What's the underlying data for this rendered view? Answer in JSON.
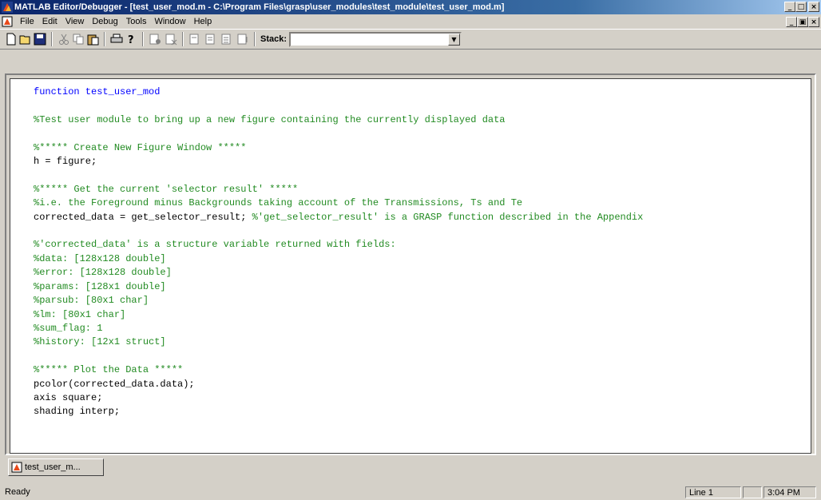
{
  "window": {
    "title": "MATLAB Editor/Debugger - [test_user_mod.m - C:\\Program Files\\grasp\\user_modules\\test_module\\test_user_mod.m]",
    "controls": {
      "minimize": "_",
      "maximize": "□",
      "close": "×"
    }
  },
  "menu": [
    {
      "label": "File"
    },
    {
      "label": "Edit"
    },
    {
      "label": "View"
    },
    {
      "label": "Debug"
    },
    {
      "label": "Tools"
    },
    {
      "label": "Window"
    },
    {
      "label": "Help"
    }
  ],
  "mdi_controls": {
    "minimize": "_",
    "restore": "▣",
    "close": "×"
  },
  "toolbar": {
    "stack_label": "Stack:",
    "stack_value": "",
    "icons": [
      "new-file-icon",
      "open-file-icon",
      "save-icon",
      "cut-icon",
      "copy-icon",
      "paste-icon",
      "print-icon",
      "help-icon",
      "set-breakpoint-icon",
      "clear-breakpoints-icon",
      "step-icon",
      "step-in-icon",
      "step-out-icon",
      "continue-icon"
    ]
  },
  "code_lines": [
    {
      "text": "function test_user_mod",
      "style": "kw"
    },
    {
      "text": "",
      "style": ""
    },
    {
      "text": "%Test user module to bring up a new figure containing the currently displayed data",
      "style": "cm"
    },
    {
      "text": "",
      "style": ""
    },
    {
      "text": "%***** Create New Figure Window *****",
      "style": "cm"
    },
    {
      "text": "h = figure;",
      "style": ""
    },
    {
      "text": "",
      "style": ""
    },
    {
      "text": "%***** Get the current 'selector result' *****",
      "style": "cm"
    },
    {
      "text": "%i.e. the Foreground minus Backgrounds taking account of the Transmissions, Ts and Te",
      "style": "cm"
    },
    {
      "text": "corrected_data = get_selector_result; ",
      "style": "",
      "comment": "%'get_selector_result' is a GRASP function described in the Appendix"
    },
    {
      "text": "",
      "style": ""
    },
    {
      "text": "%'corrected_data' is a structure variable returned with fields:",
      "style": "cm"
    },
    {
      "text": "%data: [128x128 double]",
      "style": "cm"
    },
    {
      "text": "%error: [128x128 double]",
      "style": "cm"
    },
    {
      "text": "%params: [128x1 double]",
      "style": "cm"
    },
    {
      "text": "%parsub: [80x1 char]",
      "style": "cm"
    },
    {
      "text": "%lm: [80x1 char]",
      "style": "cm"
    },
    {
      "text": "%sum_flag: 1",
      "style": "cm"
    },
    {
      "text": "%history: [12x1 struct]",
      "style": "cm"
    },
    {
      "text": "",
      "style": ""
    },
    {
      "text": "%***** Plot the Data *****",
      "style": "cm"
    },
    {
      "text": "pcolor(corrected_data.data);",
      "style": ""
    },
    {
      "text": "axis square;",
      "style": ""
    },
    {
      "text": "shading interp;",
      "style": ""
    }
  ],
  "tabs": [
    {
      "label": "test_user_m..."
    }
  ],
  "status": {
    "text": "Ready",
    "line": "Line 1",
    "col": "",
    "time": "3:04 PM"
  }
}
